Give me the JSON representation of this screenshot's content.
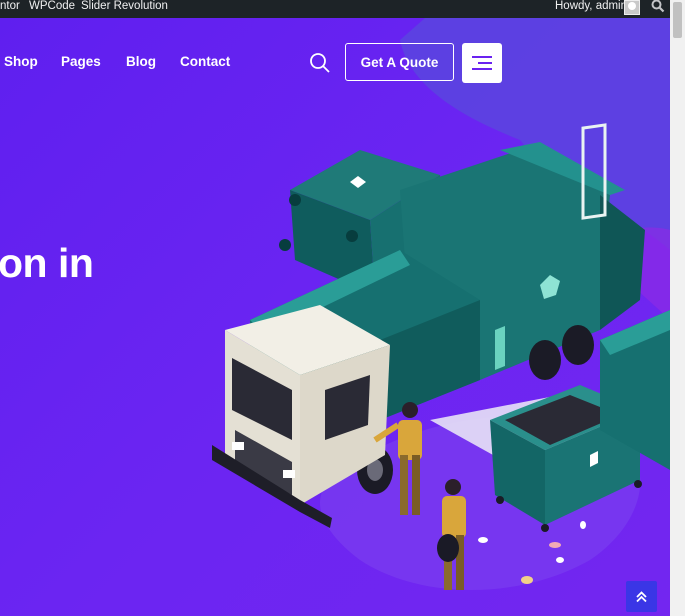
{
  "adminbar": {
    "items": [
      "ntor",
      "WPCode",
      "Slider Revolution"
    ],
    "greeting": "Howdy, admin"
  },
  "header": {
    "nav": [
      "Shop",
      "Pages",
      "Blog",
      "Contact"
    ],
    "quote_label": "Get A Quote"
  },
  "hero": {
    "headline": "on in"
  },
  "icons": {
    "search": "search-icon",
    "menu": "hamburger-menu-icon",
    "scroll_top": "double-chevron-up-icon",
    "avatar": "user-avatar-icon"
  },
  "colors": {
    "adminbar_bg": "#1d2327",
    "hero_bg": "#6a22f0",
    "blob": "#5b44df",
    "truck_teal": "#136b6b",
    "to_top": "#3a36e6"
  }
}
